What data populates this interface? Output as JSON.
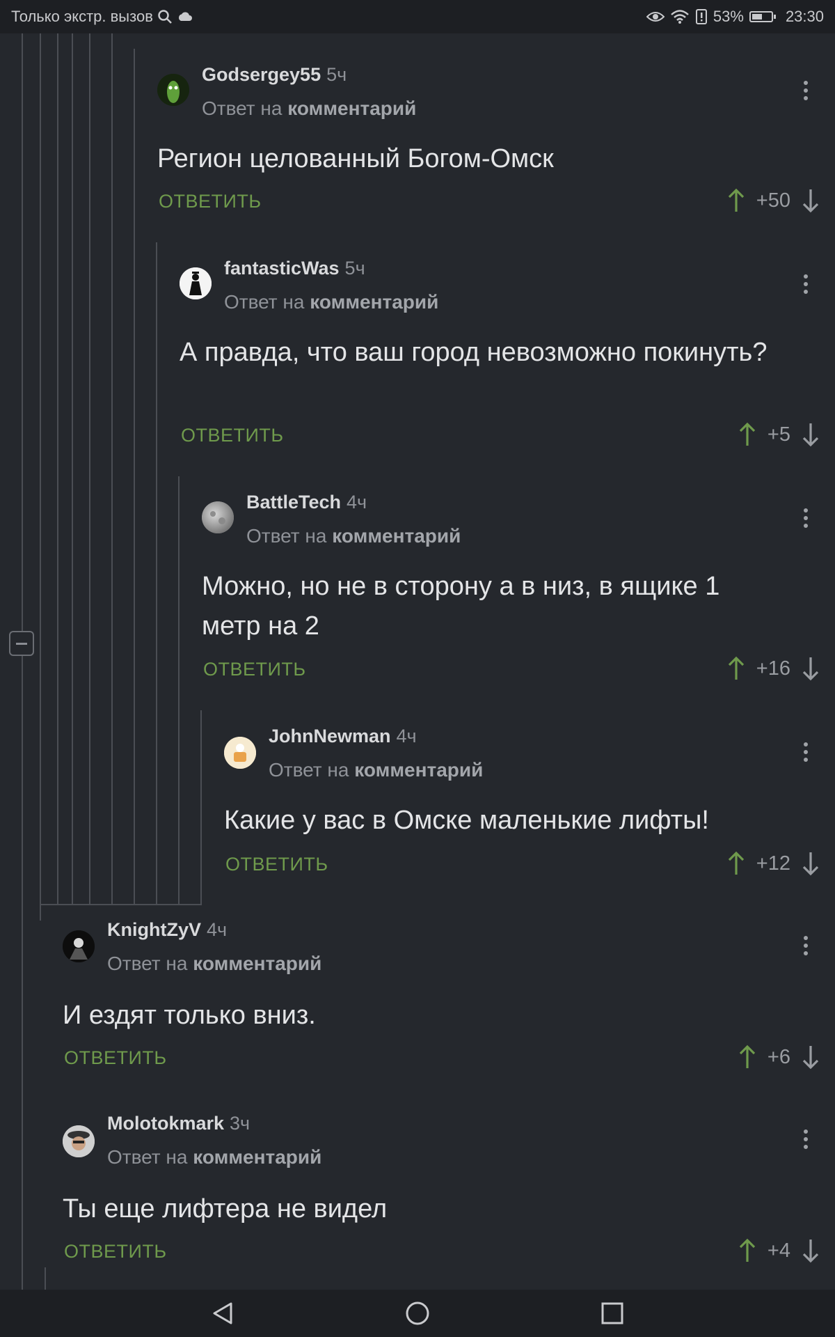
{
  "statusbar": {
    "carrier": "Только экстр. вызов",
    "battery": "53%",
    "time": "23:30",
    "battery_level": 0.53
  },
  "comments": [
    {
      "author": "Godsergey55",
      "time": "5ч",
      "reply_prefix": "Ответ на",
      "reply_target": "комментарий",
      "text": "Регион целованный Богом-Омск",
      "reply_label": "ОТВЕТИТЬ",
      "score": "+50"
    },
    {
      "author": "fantasticWas",
      "time": "5ч",
      "reply_prefix": "Ответ на",
      "reply_target": "комментарий",
      "text": "А правда, что ваш город невозможно покинуть?",
      "reply_label": "ОТВЕТИТЬ",
      "score": "+5"
    },
    {
      "author": "BattleTech",
      "time": "4ч",
      "reply_prefix": "Ответ на",
      "reply_target": "комментарий",
      "text": "Можно, но не в сторону а в низ, в ящике 1 метр на 2",
      "reply_label": "ОТВЕТИТЬ",
      "score": "+16"
    },
    {
      "author": "JohnNewman",
      "time": "4ч",
      "reply_prefix": "Ответ на",
      "reply_target": "комментарий",
      "text": "Какие у вас в Омске маленькие лифты!",
      "reply_label": "ОТВЕТИТЬ",
      "score": "+12"
    },
    {
      "author": "KnightZyV",
      "time": "4ч",
      "reply_prefix": "Ответ на",
      "reply_target": "комментарий",
      "text": "И ездят только вниз.",
      "reply_label": "ОТВЕТИТЬ",
      "score": "+6"
    },
    {
      "author": "Molotokmark",
      "time": "3ч",
      "reply_prefix": "Ответ на",
      "reply_target": "комментарий",
      "text": "Ты еще лифтера не видел",
      "reply_label": "ОТВЕТИТЬ",
      "score": "+4"
    }
  ],
  "colors": {
    "background": "#25282d",
    "accent_green": "#6f9a4c",
    "bars": "#1d1f23"
  }
}
